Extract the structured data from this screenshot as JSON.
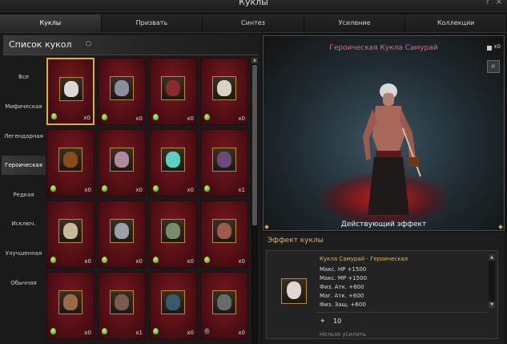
{
  "window": {
    "title": "Куклы",
    "help": "?",
    "close": "×"
  },
  "tabs": [
    {
      "label": "Куклы"
    },
    {
      "label": "Призвать"
    },
    {
      "label": "Синтез"
    },
    {
      "label": "Усиление"
    },
    {
      "label": "Коллекции"
    }
  ],
  "list": {
    "header": "Список кукол",
    "categories": [
      {
        "label": "Все"
      },
      {
        "label": "Мифическая"
      },
      {
        "label": "Легендарная"
      },
      {
        "label": "Героическая"
      },
      {
        "label": "Редкая"
      },
      {
        "label": "Исключ."
      },
      {
        "label": "Улучшенная"
      },
      {
        "label": "Обычная"
      }
    ],
    "selected_category": "Героическая",
    "cards": [
      {
        "count": "x0",
        "color": "#d8d8d8"
      },
      {
        "count": "x0",
        "color": "#8a8fa0"
      },
      {
        "count": "x0",
        "color": "#8a2a2a"
      },
      {
        "count": "x0",
        "color": "#d9d3c2"
      },
      {
        "count": "x0",
        "color": "#8a4a20"
      },
      {
        "count": "x0",
        "color": "#b08a9a"
      },
      {
        "count": "x0",
        "color": "#5ad0c0"
      },
      {
        "count": "x1",
        "color": "#6a4a7a"
      },
      {
        "count": "x0",
        "color": "#c9b89a"
      },
      {
        "count": "x0",
        "color": "#9aa0a8"
      },
      {
        "count": "x0",
        "color": "#7a8a6a"
      },
      {
        "count": "x0",
        "color": "#a05a4a"
      },
      {
        "count": "x0",
        "color": "#9a6a4a"
      },
      {
        "count": "x1",
        "color": "#7a5a4a"
      },
      {
        "count": "x0",
        "color": "#3a5a6a"
      },
      {
        "count": "x0",
        "color": "#6a6a6a"
      }
    ]
  },
  "preview": {
    "title": "Героическая Кукла Самурай",
    "bag_count": "x0",
    "effect_button": "Действующий эффект"
  },
  "effect": {
    "header": "Эффект куклы",
    "name": "Кукла Самурай - Героическая",
    "stats": [
      "Макс. HP +1500",
      "Макс. MP +1500",
      "Физ. Атк. +600",
      "Маг. Атк. +600",
      "Физ. Защ. +600"
    ],
    "level": "10",
    "note": "Нельзя усилить"
  },
  "colors": {
    "accent": "#e6b44c",
    "title_red": "#e86a6a",
    "card_red": "#7a1820"
  }
}
